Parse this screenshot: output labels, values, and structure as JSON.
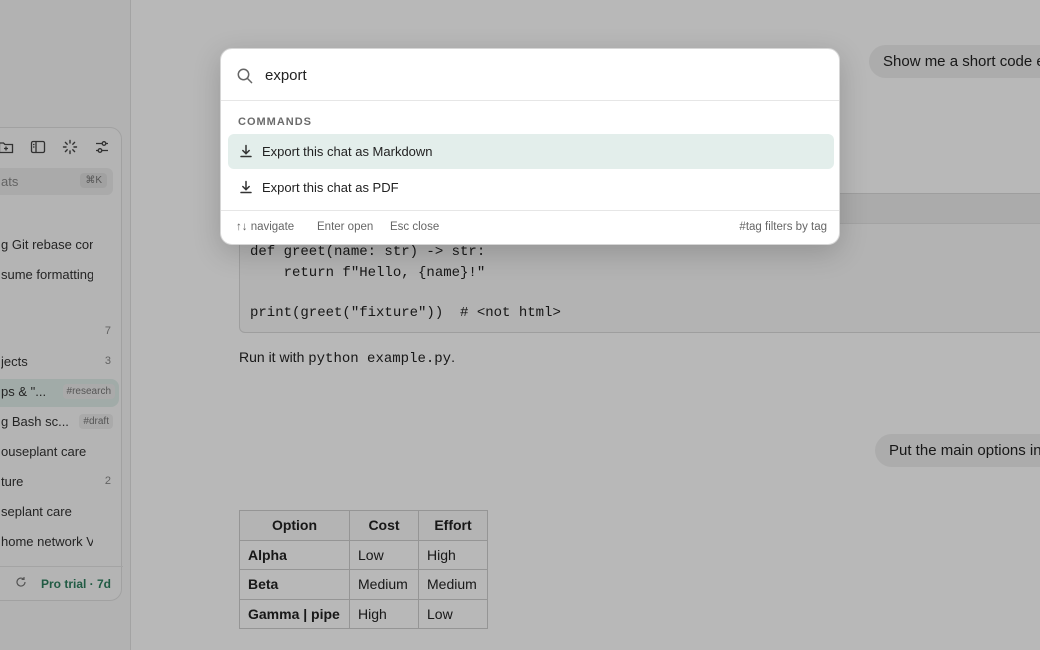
{
  "sidebar": {
    "search_placeholder": "ats",
    "search_shortcut": "⌘K",
    "items": [
      {
        "label": "g Git rebase con...",
        "count": "",
        "tag": ""
      },
      {
        "label": "sume formatting",
        "count": "",
        "tag": ""
      },
      {
        "label": "",
        "count": "7",
        "tag": ""
      },
      {
        "label": "jects",
        "count": "3",
        "tag": ""
      },
      {
        "label": "ps & \"...",
        "count": "",
        "tag": "#research"
      },
      {
        "label": "g Bash sc...",
        "count": "",
        "tag": "#draft"
      },
      {
        "label": "ouseplant care",
        "count": "",
        "tag": ""
      },
      {
        "label": "ture",
        "count": "2",
        "tag": ""
      },
      {
        "label": "seplant care",
        "count": "",
        "tag": ""
      },
      {
        "label": "home network VL...",
        "count": "",
        "tag": ""
      }
    ],
    "footer_trial": "Pro trial · 7d"
  },
  "chat": {
    "user_message_1": "Show me a short code ex",
    "code_lines": [
      "def greet(name: str) -> str:",
      "    return f\"Hello, {name}!\"",
      "",
      "print(greet(\"fixture\"))  # <not html>"
    ],
    "run_prefix": "Run it with ",
    "run_code": "python example.py",
    "run_suffix": ".",
    "user_message_2": "Put the main options in",
    "table": {
      "headers": [
        "Option",
        "Cost",
        "Effort"
      ],
      "rows": [
        [
          "Alpha",
          "Low",
          "High"
        ],
        [
          "Beta",
          "Medium",
          "Medium"
        ],
        [
          "Gamma | pipe",
          "High",
          "Low"
        ]
      ]
    }
  },
  "palette": {
    "query": "export",
    "section_label": "COMMANDS",
    "items": [
      {
        "label": "Export this chat as Markdown",
        "icon": "download-icon",
        "selected": true
      },
      {
        "label": "Export this chat as PDF",
        "icon": "download-icon",
        "selected": false
      }
    ],
    "footer": {
      "navigate": "↑↓ navigate",
      "open": "Enter open",
      "close": "Esc close",
      "tag_hint": "#tag filters by tag"
    }
  },
  "colors": {
    "selected_row": "#e3eeeb",
    "trial_green": "#2f7f5f",
    "scrim": "rgba(0,0,0,0.28)"
  }
}
